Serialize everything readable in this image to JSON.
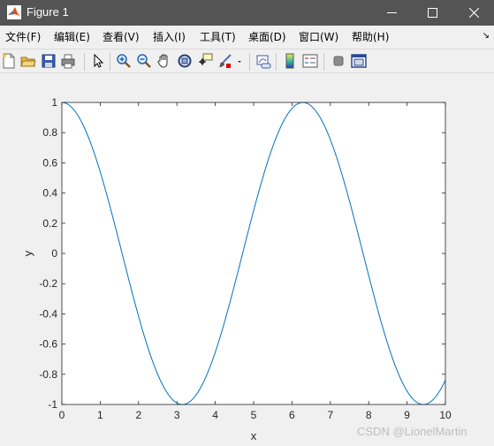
{
  "window": {
    "title": "Figure 1"
  },
  "menu": {
    "items": [
      {
        "label": "文件(F)"
      },
      {
        "label": "编辑(E)"
      },
      {
        "label": "查看(V)"
      },
      {
        "label": "插入(I)"
      },
      {
        "label": "工具(T)"
      },
      {
        "label": "桌面(D)"
      },
      {
        "label": "窗口(W)"
      },
      {
        "label": "帮助(H)"
      }
    ],
    "overflow_arrow": "↘"
  },
  "toolbar": {
    "icons": [
      "new-figure-icon",
      "open-file-icon",
      "save-icon",
      "print-icon",
      "pointer-icon",
      "zoom-in-icon",
      "zoom-out-icon",
      "pan-hand-icon",
      "rotate-3d-icon",
      "data-cursor-icon",
      "brush-icon",
      "link-plot-icon",
      "colorbar-icon",
      "legend-icon",
      "hide-plot-tools-icon",
      "show-plot-tools-icon"
    ]
  },
  "watermark": "CSDN @LionelMartin",
  "chart_data": {
    "type": "line",
    "function_shown": "cos(x)",
    "x_range": [
      0,
      10
    ],
    "series": [
      {
        "color": "#0072bd",
        "x": [
          0,
          0.5,
          1,
          1.5,
          2,
          2.5,
          3,
          3.14,
          3.5,
          4,
          4.5,
          5,
          5.5,
          6,
          6.28,
          6.5,
          7,
          7.5,
          8,
          8.5,
          9,
          9.42,
          9.5,
          10
        ],
        "y": [
          1,
          0.878,
          0.54,
          0.071,
          -0.416,
          -0.801,
          -0.99,
          -1,
          -0.936,
          -0.654,
          -0.211,
          0.284,
          0.709,
          0.96,
          1,
          0.977,
          0.754,
          0.347,
          -0.146,
          -0.602,
          -0.911,
          -1,
          -0.997,
          -0.839
        ]
      }
    ],
    "xlabel": "x",
    "ylabel": "y",
    "xlim": [
      0,
      10
    ],
    "ylim": [
      -1,
      1
    ],
    "xticks": [
      "0",
      "1",
      "2",
      "3",
      "4",
      "5",
      "6",
      "7",
      "8",
      "9",
      "10"
    ],
    "yticks": [
      "-1",
      "-0.8",
      "-0.6",
      "-0.4",
      "-0.2",
      "0",
      "0.2",
      "0.4",
      "0.6",
      "0.8",
      "1"
    ],
    "grid": false,
    "box": true
  }
}
